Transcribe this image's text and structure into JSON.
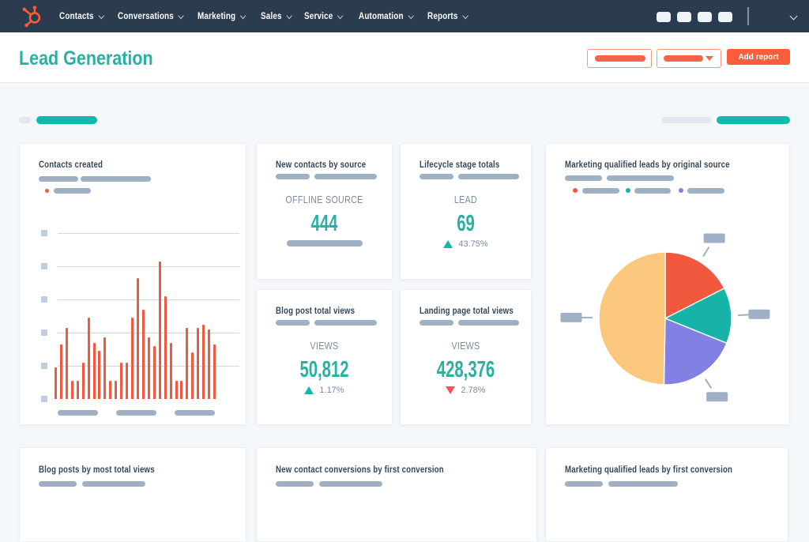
{
  "navbar": {
    "menu": [
      {
        "label": "Contacts"
      },
      {
        "label": "Conversations"
      },
      {
        "label": "Marketing"
      },
      {
        "label": "Sales"
      },
      {
        "label": "Service"
      },
      {
        "label": "Automation"
      },
      {
        "label": "Reports"
      }
    ]
  },
  "header": {
    "title": "Lead Generation",
    "add_report_label": "Add report"
  },
  "kpis": [
    {
      "title": "New contacts by source",
      "metric_label": "OFFLINE SOURCE",
      "value": "444"
    },
    {
      "title": "Lifecycle stage totals",
      "metric_label": "LEAD",
      "value": "69",
      "delta": "43.75%",
      "direction": "up"
    },
    {
      "title": "Blog post total views",
      "metric_label": "VIEWS",
      "value": "50,812",
      "delta": "1.17%",
      "direction": "up"
    },
    {
      "title": "Landing page total views",
      "metric_label": "VIEWS",
      "value": "428,376",
      "delta": "2.78%",
      "direction": "down"
    }
  ],
  "bottom_cards": [
    {
      "title": "Blog posts by most total views"
    },
    {
      "title": "New contact conversions by first conversion"
    },
    {
      "title": "Marketing qualified leads by first conversion"
    }
  ],
  "chart_data": [
    {
      "type": "bar",
      "title": "Contacts created",
      "values": [
        19,
        33,
        43,
        11,
        11,
        22,
        49,
        34,
        29,
        37,
        11,
        11,
        22,
        22,
        49,
        73,
        54,
        37,
        32,
        83,
        62,
        34,
        11,
        11,
        43,
        28,
        43,
        45,
        42,
        33
      ],
      "ylim": [
        0,
        100
      ],
      "gridline_count": 6,
      "x_tick_groups": 3,
      "bar_color": "#f2583e",
      "note": "axis tick and legend labels are skeleton placeholder blocks"
    },
    {
      "type": "pie",
      "title": "Marketing qualified leads by original source",
      "slices": [
        {
          "label": "slice-1",
          "value": 17.5,
          "color": "#f2583e"
        },
        {
          "label": "slice-2",
          "value": 13.6,
          "color": "#17b3a8"
        },
        {
          "label": "slice-3",
          "value": 19.2,
          "color": "#8280e2"
        },
        {
          "label": "slice-4",
          "value": 49.7,
          "color": "#fbc77d"
        }
      ],
      "legend_colors": [
        "#f2583e",
        "#17b3a8",
        "#8280e2"
      ],
      "start_angle_deg": 0,
      "note": "legend and slice callout labels are skeleton placeholder blocks"
    }
  ],
  "colors": {
    "navbar_bg": "#2b3c4f",
    "page_bg": "#f5f8fa",
    "accent_teal": "#28b0a2",
    "accent_orange": "#f95d39",
    "negative_red": "#f2545b",
    "heading_text": "#33475b",
    "muted_text": "#7c8ba0",
    "skeleton_pill": "#9fb0c4"
  }
}
